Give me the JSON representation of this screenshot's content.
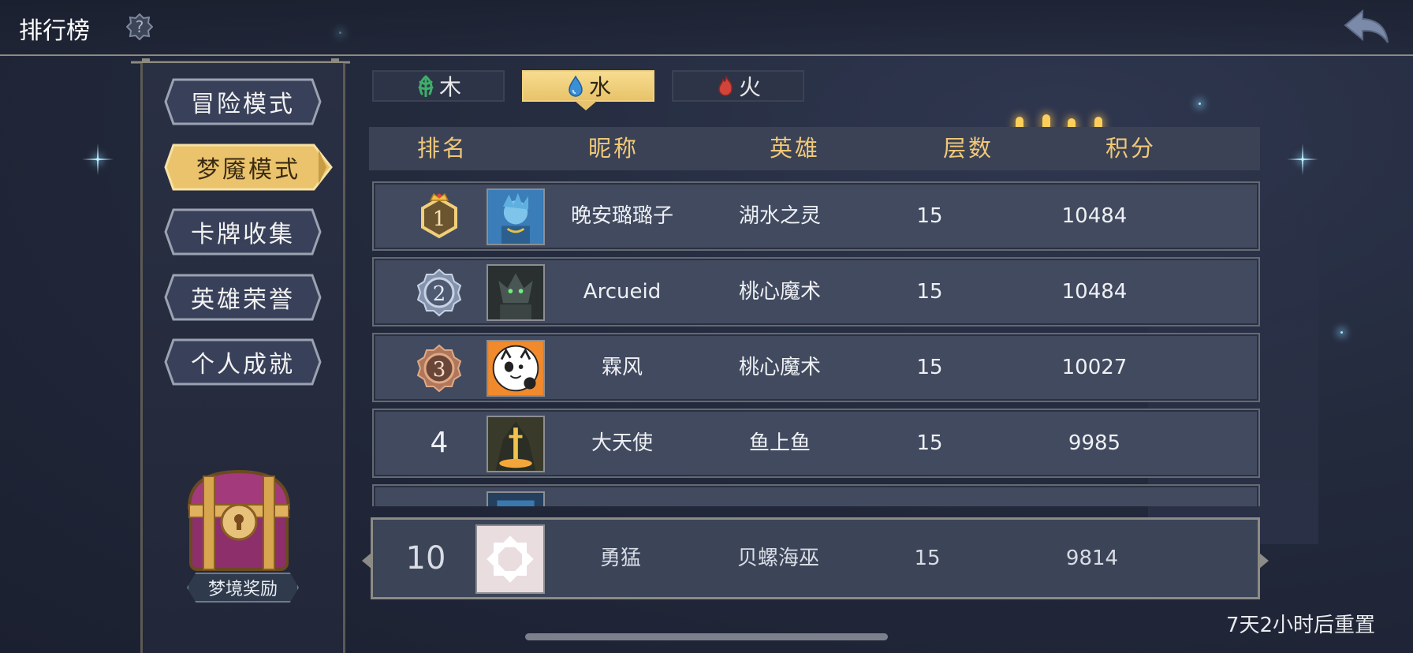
{
  "header": {
    "title": "排行榜",
    "help_icon": "question-icon",
    "back_icon": "back-arrow-icon"
  },
  "sidebar": {
    "items": [
      {
        "label": "冒险模式",
        "active": false
      },
      {
        "label": "梦魇模式",
        "active": true
      },
      {
        "label": "卡牌收集",
        "active": false
      },
      {
        "label": "英雄荣誉",
        "active": false
      },
      {
        "label": "个人成就",
        "active": false
      }
    ],
    "reward_label": "梦境奖励"
  },
  "tabs": [
    {
      "label": "木",
      "icon": "leaf-icon",
      "color": "#3fae6a",
      "active": false
    },
    {
      "label": "水",
      "icon": "water-drop-icon",
      "color": "#3a8fd6",
      "active": true
    },
    {
      "label": "火",
      "icon": "fire-icon",
      "color": "#d0443a",
      "active": false
    }
  ],
  "table": {
    "columns": [
      "排名",
      "昵称",
      "英雄",
      "层数",
      "积分"
    ],
    "rows": [
      {
        "rank": "1",
        "nickname": "晚安璐璐子",
        "hero": "湖水之灵",
        "floors": "15",
        "score": "10484",
        "badge": "gold-crown"
      },
      {
        "rank": "2",
        "nickname": "Arcueid",
        "hero": "桃心魔术",
        "floors": "15",
        "score": "10484",
        "badge": "silver"
      },
      {
        "rank": "3",
        "nickname": "霖风",
        "hero": "桃心魔术",
        "floors": "15",
        "score": "10027",
        "badge": "bronze"
      },
      {
        "rank": "4",
        "nickname": "大天使",
        "hero": "鱼上鱼",
        "floors": "15",
        "score": "9985",
        "badge": "none"
      }
    ]
  },
  "my_rank": {
    "rank": "10",
    "nickname": "勇猛",
    "hero": "贝螺海巫",
    "floors": "15",
    "score": "9814"
  },
  "reset_text": "7天2小时后重置",
  "colors": {
    "accent_gold": "#f0c877",
    "panel": "#414a5f",
    "header": "#3b4256"
  }
}
